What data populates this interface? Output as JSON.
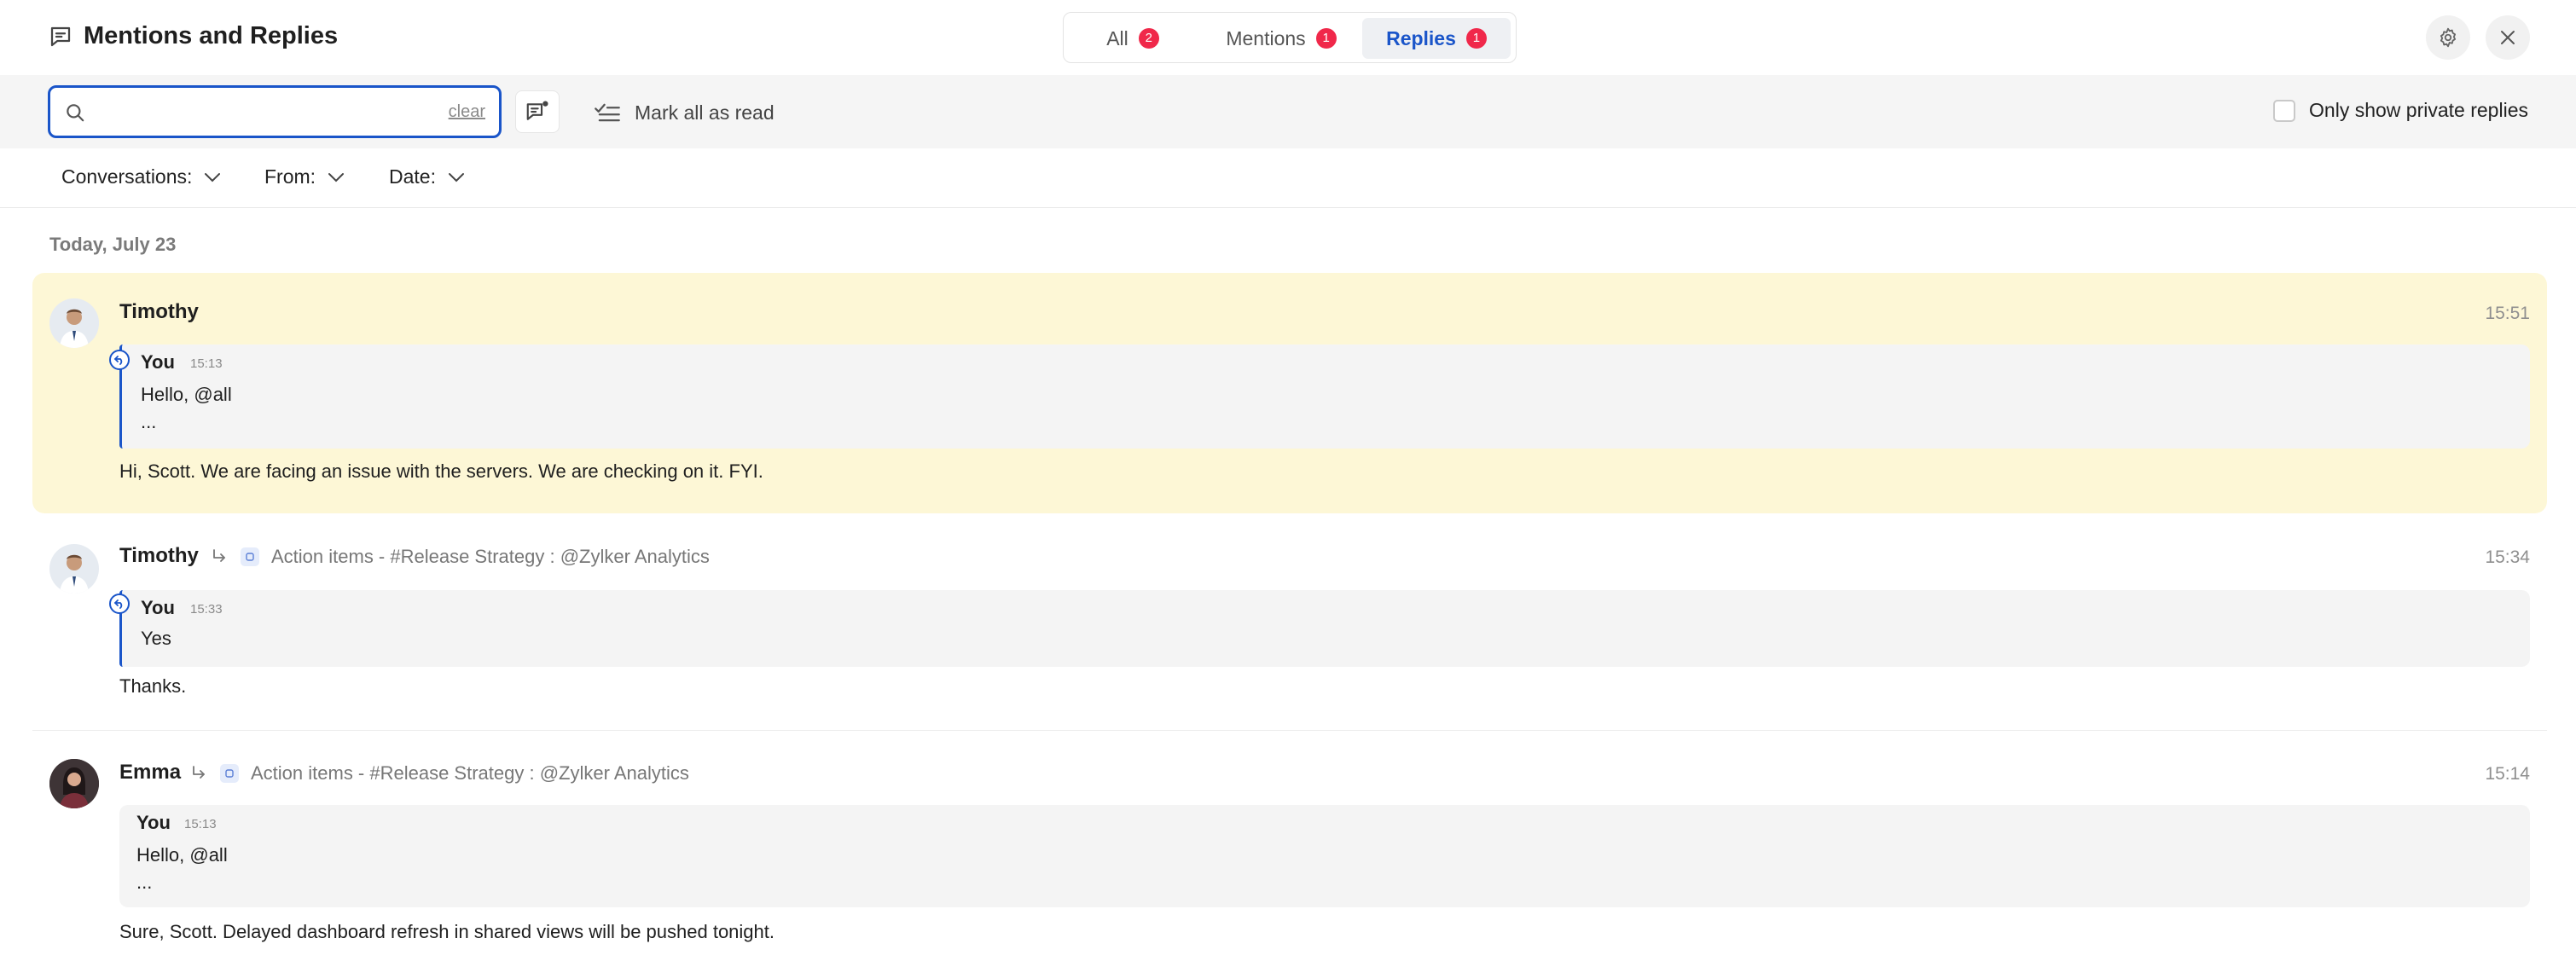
{
  "header": {
    "title": "Mentions and Replies",
    "icon": "chat-bubble-icon",
    "tabs": [
      {
        "label": "All",
        "count": "2",
        "active": false
      },
      {
        "label": "Mentions",
        "count": "1",
        "active": false
      },
      {
        "label": "Replies",
        "count": "1",
        "active": true
      }
    ],
    "settings_icon": "gear-icon",
    "close_icon": "close-icon"
  },
  "toolbar": {
    "search": {
      "value": "",
      "placeholder": "",
      "clear_label": "clear"
    },
    "compose_icon": "compose-message-icon",
    "mark_all_read": "Mark all as read",
    "private_only": {
      "label": "Only show private replies",
      "checked": false
    }
  },
  "filters": [
    {
      "label": "Conversations:"
    },
    {
      "label": "From:"
    },
    {
      "label": "Date:"
    }
  ],
  "date_group": "Today, July 23",
  "messages": [
    {
      "sender": "Timothy",
      "time": "15:51",
      "highlighted": true,
      "thread": "",
      "quote": {
        "author": "You",
        "time": "15:13",
        "lines": [
          "Hello, @all",
          "..."
        ]
      },
      "text": "Hi, Scott. We are facing an issue with the servers. We are checking on it. FYI."
    },
    {
      "sender": "Timothy",
      "time": "15:34",
      "highlighted": false,
      "thread": "Action items - #Release Strategy : @Zylker Analytics",
      "quote": {
        "author": "You",
        "time": "15:33",
        "lines": [
          "Yes"
        ]
      },
      "text": "Thanks."
    },
    {
      "sender": "Emma",
      "time": "15:14",
      "highlighted": false,
      "thread": "Action items - #Release Strategy : @Zylker Analytics",
      "quote": {
        "author": "You",
        "time": "15:13",
        "lines": [
          "Hello, @all",
          "..."
        ]
      },
      "text": "Sure, Scott. Delayed dashboard refresh in shared views will be pushed tonight."
    }
  ],
  "colors": {
    "accent": "#1a55c9",
    "badge": "#f0284a",
    "highlight": "#fdf7d6",
    "toolbar_bg": "#f5f5f5",
    "quote_bg": "#f4f4f4"
  }
}
